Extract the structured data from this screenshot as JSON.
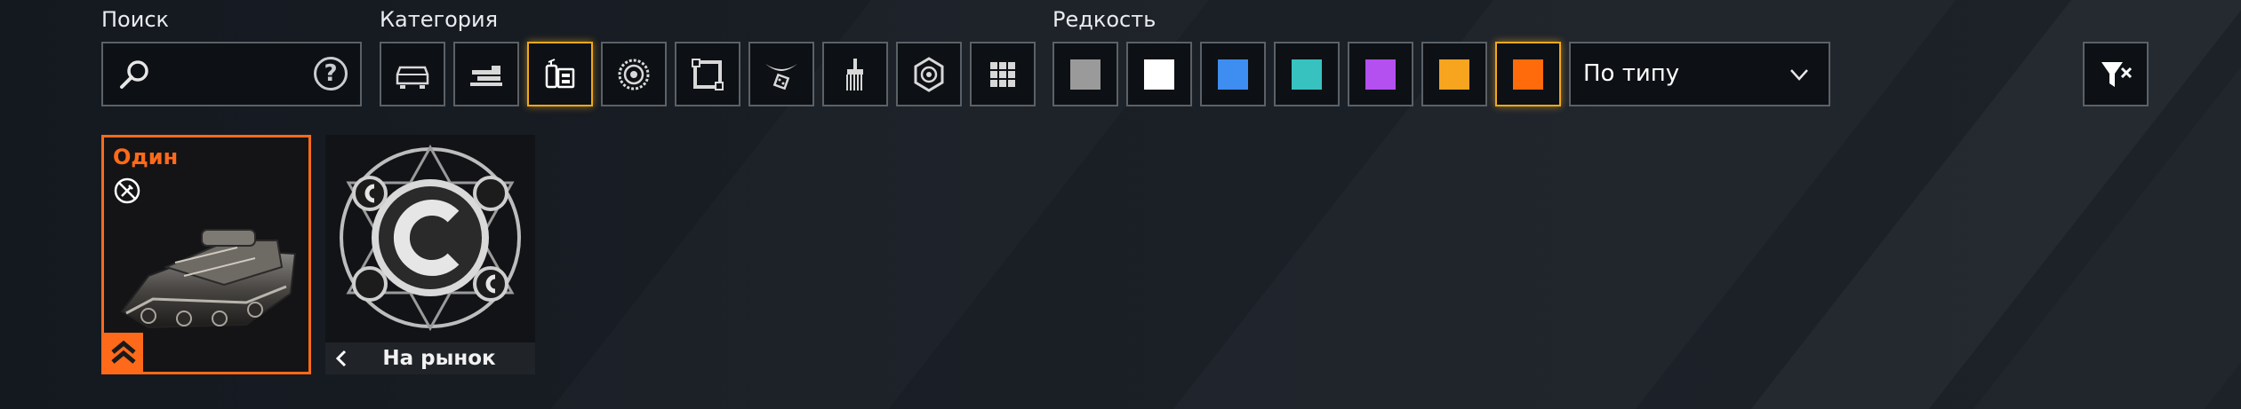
{
  "filters": {
    "search": {
      "label": "Поиск",
      "value": "",
      "placeholder": ""
    },
    "category": {
      "label": "Категория",
      "items": [
        {
          "icon": "vehicle-cabin-icon",
          "selected": false
        },
        {
          "icon": "weapon-icon",
          "selected": false
        },
        {
          "icon": "module-icon",
          "selected": true
        },
        {
          "icon": "wheel-icon",
          "selected": false
        },
        {
          "icon": "structure-icon",
          "selected": false
        },
        {
          "icon": "decor-icon",
          "selected": false
        },
        {
          "icon": "paint-icon",
          "selected": false
        },
        {
          "icon": "resource-icon",
          "selected": false
        },
        {
          "icon": "all-items-icon",
          "selected": false
        }
      ]
    },
    "rarity": {
      "label": "Редкость",
      "items": [
        {
          "name": "common",
          "color": "#9a9a9a",
          "selected": false
        },
        {
          "name": "uncommon",
          "color": "#ffffff",
          "selected": false
        },
        {
          "name": "rare",
          "color": "#3d8ef0",
          "selected": false
        },
        {
          "name": "special",
          "color": "#37c2c0",
          "selected": false
        },
        {
          "name": "epic",
          "color": "#b44ff0",
          "selected": false
        },
        {
          "name": "legendary",
          "color": "#f7a41f",
          "selected": false
        },
        {
          "name": "relic",
          "color": "#ff6a0a",
          "selected": true
        }
      ]
    },
    "sort": {
      "value": "По типу"
    }
  },
  "items": [
    {
      "title": "Один",
      "selected": true,
      "accent": "#ff6a1a"
    },
    {
      "action": "На рынок"
    }
  ],
  "colors": {
    "accent": "#f0a91c",
    "border": "#5b6168",
    "relic": "#ff6a1a"
  }
}
